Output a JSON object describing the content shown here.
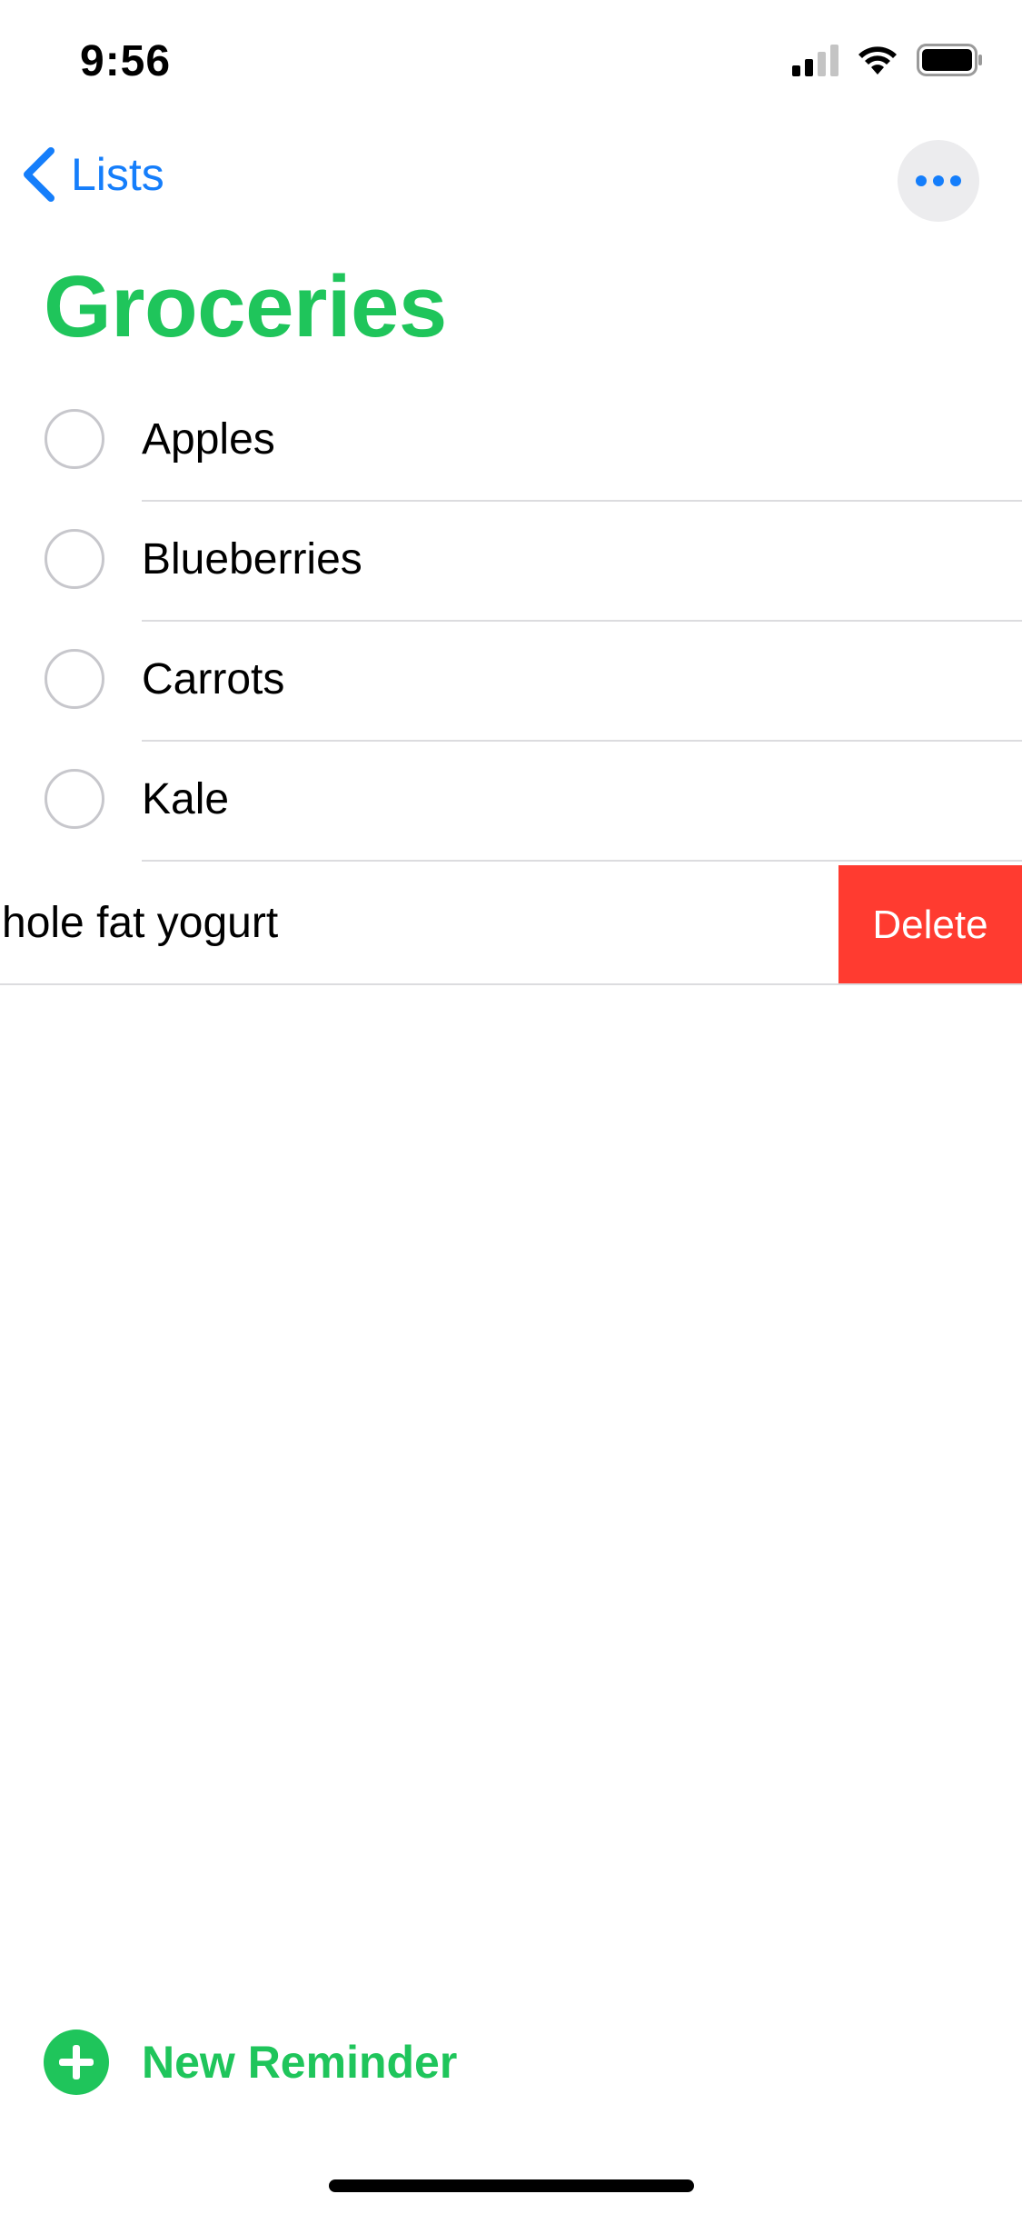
{
  "status_bar": {
    "time": "9:56"
  },
  "nav": {
    "back_label": "Lists",
    "back_icon": "chevron-left-icon",
    "more_icon": "ellipsis-icon"
  },
  "list": {
    "title": "Groceries",
    "items": [
      {
        "label": "Apples"
      },
      {
        "label": "Blueberries"
      },
      {
        "label": "Carrots"
      },
      {
        "label": "Kale"
      }
    ],
    "swiped_item": {
      "label": "hole fat yogurt",
      "action_label": "Delete"
    }
  },
  "footer": {
    "new_reminder_label": "New Reminder",
    "new_reminder_icon": "plus-circle-icon"
  },
  "colors": {
    "accent_green": "#1fc55b",
    "link_blue": "#157efb",
    "delete_red": "#ff3b30",
    "more_button_bg": "#ececee"
  }
}
